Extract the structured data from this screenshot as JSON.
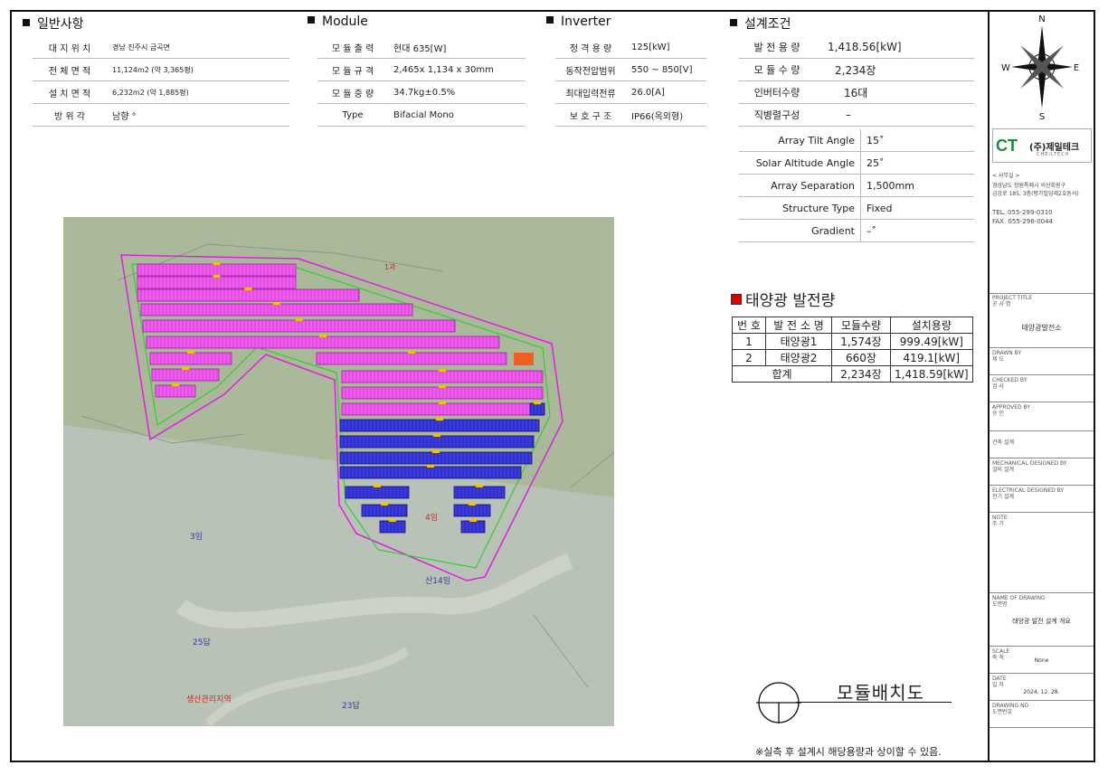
{
  "general": {
    "title": "일반사항",
    "rows": [
      {
        "key": "대 지 위 치",
        "value": "경남 진주시 금곡면"
      },
      {
        "key": "전 체 면 적",
        "value": "11,124m2 (약 3,365평)"
      },
      {
        "key": "설 치 면 적",
        "value": "6,232m2 (약 1,885평)"
      },
      {
        "key": "방   위   각",
        "value": "남향 °"
      }
    ]
  },
  "module": {
    "title": "Module",
    "rows": [
      {
        "key": "모 듈 출 력",
        "value": "현대 635[W]"
      },
      {
        "key": "모 듈 규 격",
        "value": "2,465x 1,134 x 30mm"
      },
      {
        "key": "모 듈 중 량",
        "value": "34.7kg±0.5%"
      },
      {
        "key": "Type",
        "value": "Bifacial Mono"
      }
    ]
  },
  "inverter": {
    "title": "Inverter",
    "rows": [
      {
        "key": "정 격 용 량",
        "value": "125[kW]"
      },
      {
        "key": "동작전압범위",
        "value": "550 ~ 850[V]"
      },
      {
        "key": "최대입력전류",
        "value": "26.0[A]"
      },
      {
        "key": "보 호 구 조",
        "value": "IP66(옥외형)"
      }
    ]
  },
  "design": {
    "title": "설계조건",
    "rows": [
      {
        "key": "발 전 용 량",
        "value": "1,418.56[kW]"
      },
      {
        "key": "모 듈 수 량",
        "value": "2,234장"
      },
      {
        "key": "인버터수량",
        "value": "16대"
      },
      {
        "key": "직병렬구성",
        "value": "–"
      }
    ],
    "rows2": [
      {
        "key": "Array Tilt Angle",
        "value": "15˚"
      },
      {
        "key": "Solar Altitude Angle",
        "value": "25˚"
      },
      {
        "key": "Array Separation",
        "value": "1,500mm"
      },
      {
        "key": "Structure Type",
        "value": "Fixed"
      },
      {
        "key": "Gradient",
        "value": "–˚"
      }
    ]
  },
  "map": {
    "labels": {
      "l1": "1과",
      "l3": "3임",
      "l4": "4임",
      "l14": "산14임",
      "l25": "25답",
      "l23": "23답",
      "zone": "생산관리지역"
    }
  },
  "generation": {
    "title": "태양광 발전량",
    "headers": [
      "번 호",
      "발 전 소 명",
      "모듈수량",
      "설치용량"
    ],
    "rows": [
      [
        "1",
        "태양광1",
        "1,574장",
        "999.49[kW]"
      ],
      [
        "2",
        "태양광2",
        "660장",
        "419.1[kW]"
      ]
    ],
    "total": {
      "label": "합계",
      "modules": "2,234장",
      "capacity": "1,418.59[kW]"
    }
  },
  "drawing_title": "모듈배치도",
  "note": "※실측 후 설계시 해당용량과 상이할 수 있음.",
  "compass": {
    "n": "N",
    "s": "S",
    "e": "E",
    "w": "W"
  },
  "company": {
    "logo_mark": "CT",
    "logo_text": "(주)제일테크",
    "logo_sub": "CHEILTECH",
    "office_label": "< 사무실 >",
    "addr1": "경상남도 창원특례시 의산회원구",
    "addr2": "금강로 185, 3층(평가빌딩제2호동서)",
    "tel": "TEL. 055-299-0310",
    "fax": "FAX. 055-296-0044"
  },
  "title_block": {
    "project_title": "PROJECT TITLE",
    "project_kr": "공 사 명",
    "project_value": "태양광발전소",
    "drawn": "DRAWN BY",
    "drawn_kr": "제 도",
    "checked": "CHECKED BY",
    "checked_kr": "검 사",
    "approved": "APPROVED BY",
    "approved_kr": "승 인",
    "arch": "건축 설계",
    "mech": "MECHANICAL DESIGNED BY",
    "mech_kr": "설비 설계",
    "elec": "ELECTRICAL DESIGNED BY",
    "elec_kr": "전기 설계",
    "note": "NOTE",
    "note_kr": "주 기",
    "drawing_name": "NAME OF DRAWING",
    "drawing_name_kr": "도면명",
    "drawing_name_value": "태양광 발전 설계 개요",
    "scale": "SCALE",
    "scale_kr": "축 척",
    "scale_value": "None",
    "date": "DATE",
    "date_kr": "일 자",
    "date_value": "2024. 12. 28.",
    "drawing_no": "DRAWING NO",
    "drawing_no_kr": "도면번호"
  }
}
